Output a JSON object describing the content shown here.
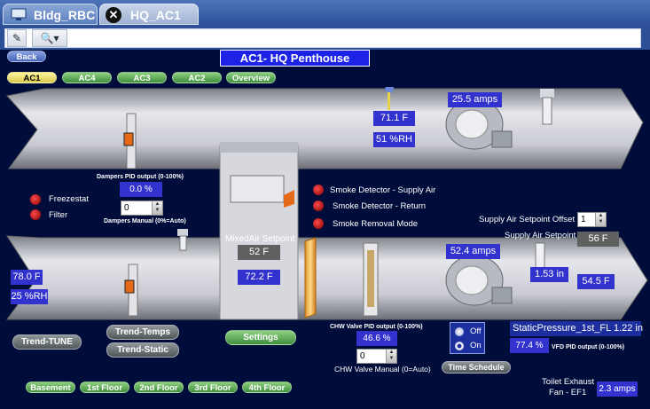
{
  "tabs": [
    {
      "label": "Bldg_RBC"
    },
    {
      "label": "HQ_AC1"
    }
  ],
  "toolbar": {
    "close_glyph": "✕",
    "edit_glyph": "✎",
    "search_glyph": "🔍▾"
  },
  "nav": {
    "back": "Back",
    "title": "AC1- HQ Penthouse"
  },
  "units": [
    "AC1",
    "AC4",
    "AC3",
    "AC2",
    "Overview"
  ],
  "top_duct": {
    "supply_amps": "25.5 amps",
    "temp": "71.1 F",
    "humidity": "51 %RH"
  },
  "dampers": {
    "pid_label": "Dampers PID output  (0-100%)",
    "pid_value": "0.0 %",
    "manual_label": "Dampers Manual (0%=Auto)",
    "manual_value": "0"
  },
  "alarms_left": [
    "Freezestat",
    "Filter"
  ],
  "alarms_center": [
    "Smoke Detector - Supply Air",
    "Smoke Detector - Return",
    "Smoke Removal Mode"
  ],
  "mixed_air": {
    "label": "MixedAir Setpoint",
    "setpoint": "52 F",
    "value": "72.2 F"
  },
  "supply_setpoint": {
    "offset_label": "Supply Air Setpoint Offset",
    "offset_value": "1",
    "label": "Supply Air Setpoint",
    "value": "56 F"
  },
  "bottom_duct": {
    "return_temp": "78.0 F",
    "return_humidity": "25 %RH",
    "supply_amps": "52.4 amps",
    "static_in": "1.53 in",
    "supply_temp": "54.5 F"
  },
  "chw": {
    "pid_label": "CHW Valve PID output  (0-100%)",
    "pid_value": "46.6 %",
    "manual_label": "CHW Valve Manual (0=Auto)",
    "manual_value": "0"
  },
  "schedule": {
    "off": "Off",
    "on": "On",
    "button": "Time Schedule"
  },
  "static_pressure": {
    "label": "StaticPressure_1st_FL",
    "value": "1.22 in",
    "vfd_value": "77.4 %",
    "vfd_label": "VFD PID output  (0-100%)"
  },
  "trend_buttons": {
    "tune": "Trend-TUNE",
    "temps": "Trend-Temps",
    "static": "Trend-Static",
    "settings": "Settings"
  },
  "floors": [
    "Basement",
    "1st Floor",
    "2nd Floor",
    "3rd Floor",
    "4th Floor"
  ],
  "exhaust": {
    "label_line1": "Toilet Exhaust",
    "label_line2": "Fan - EF1",
    "amps": "2.3 amps"
  }
}
